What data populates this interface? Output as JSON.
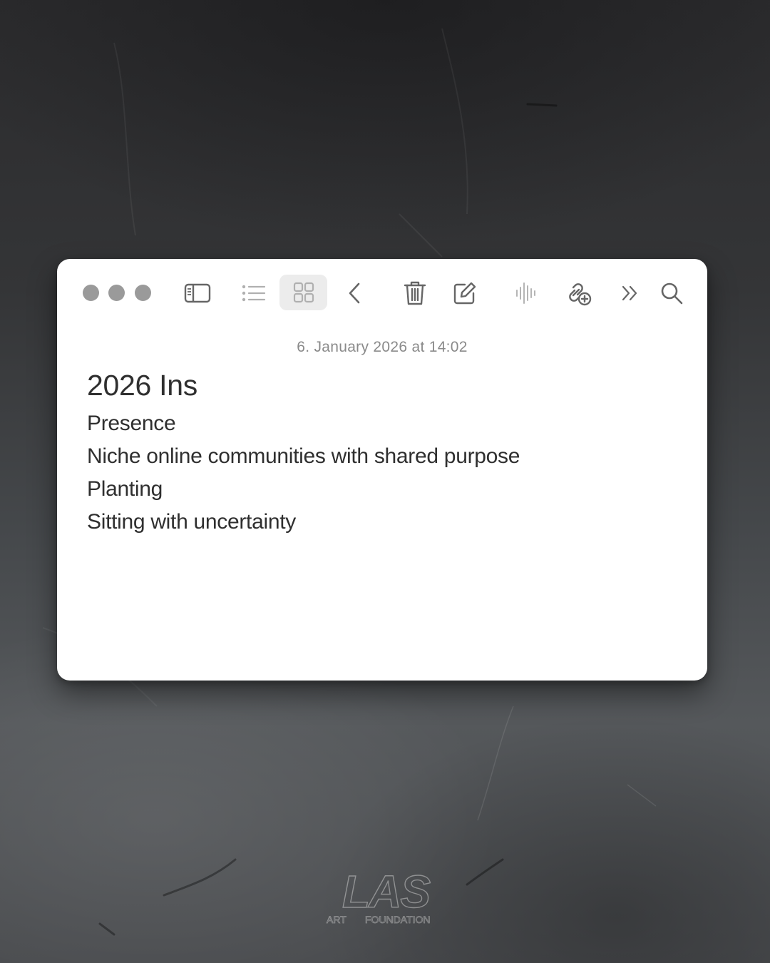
{
  "window": {
    "toolbar": {
      "buttons": [
        {
          "icon": "sidebar-icon",
          "label": "Toggle sidebar"
        },
        {
          "icon": "list-view-icon",
          "label": "List view"
        },
        {
          "icon": "gallery-view-icon",
          "label": "Gallery view",
          "active": true
        },
        {
          "icon": "chevron-left-icon",
          "label": "Back"
        },
        {
          "icon": "trash-icon",
          "label": "Delete"
        },
        {
          "icon": "compose-icon",
          "label": "New note"
        },
        {
          "icon": "audio-waveform-icon",
          "label": "Audio"
        },
        {
          "icon": "link-add-icon",
          "label": "Add link"
        },
        {
          "icon": "chevrons-right-icon",
          "label": "More"
        },
        {
          "icon": "search-icon",
          "label": "Search"
        }
      ]
    },
    "note": {
      "date": "6. January 2026 at 14:02",
      "title": "2026 Ins",
      "lines": [
        "Presence",
        "Niche online communities with shared purpose",
        "Planting",
        "Sitting with uncertainty"
      ]
    }
  },
  "logo": {
    "text_main": "LAS",
    "text_sub_left": "ART",
    "text_sub_right": "FOUNDATION"
  },
  "colors": {
    "traffic_light": "#9a9a9a",
    "icon": "#666666",
    "icon_disabled": "#b5b5b5",
    "active_tool_bg": "#ececec",
    "date_text": "#8a8a8a",
    "note_text": "#2f2f2f"
  }
}
